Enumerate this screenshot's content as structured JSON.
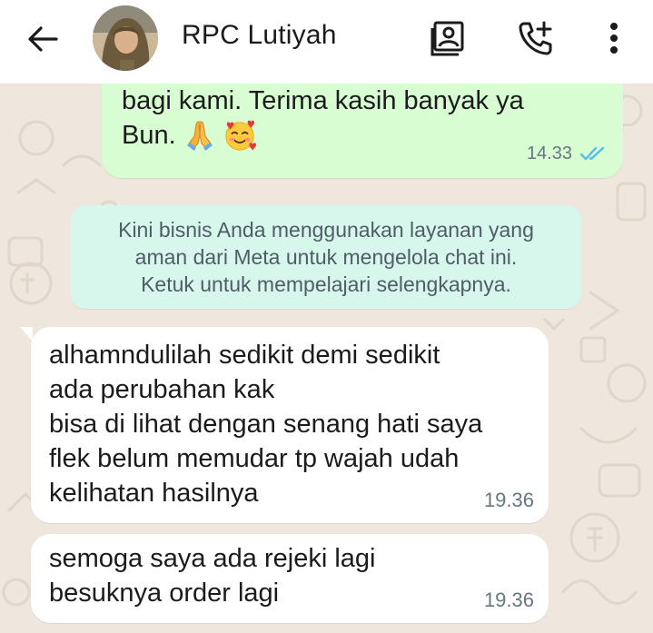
{
  "header": {
    "contact_name": "RPC Lutiyah",
    "icons": {
      "back": "arrow-left-icon",
      "contact_card": "contact-card-icon",
      "add_call": "add-call-icon",
      "menu": "more-vert-icon"
    }
  },
  "messages": [
    {
      "direction": "outgoing",
      "lines": [
        "bagi kami. Terima kasih banyak ya",
        "Bun."
      ],
      "emojis": [
        "folded-hands-emoji",
        "smiling-face-with-hearts-emoji"
      ],
      "time": "14.33",
      "status": "read"
    }
  ],
  "system_note": {
    "lines": [
      "Kini bisnis Anda menggunakan layanan yang",
      "aman dari Meta untuk mengelola chat ini.",
      "Ketuk untuk mempelajari selengkapnya."
    ]
  },
  "incoming": [
    {
      "lines": [
        "alhamndulilah sedikit demi sedikit",
        "ada perubahan kak",
        "bisa di lihat dengan senang hati saya",
        "flek belum memudar tp wajah udah",
        "kelihatan hasilnya"
      ],
      "time": "19.36"
    },
    {
      "lines": [
        "semoga saya ada rejeki lagi",
        "besuknya order lagi"
      ],
      "time": "19.36"
    }
  ],
  "colors": {
    "header_bg": "#ffffff",
    "chat_bg": "#efe7de",
    "outgoing_bubble": "#d9fdd3",
    "incoming_bubble": "#ffffff",
    "system_note_bg": "#d8f7ec",
    "read_ticks": "#53bdeb"
  }
}
